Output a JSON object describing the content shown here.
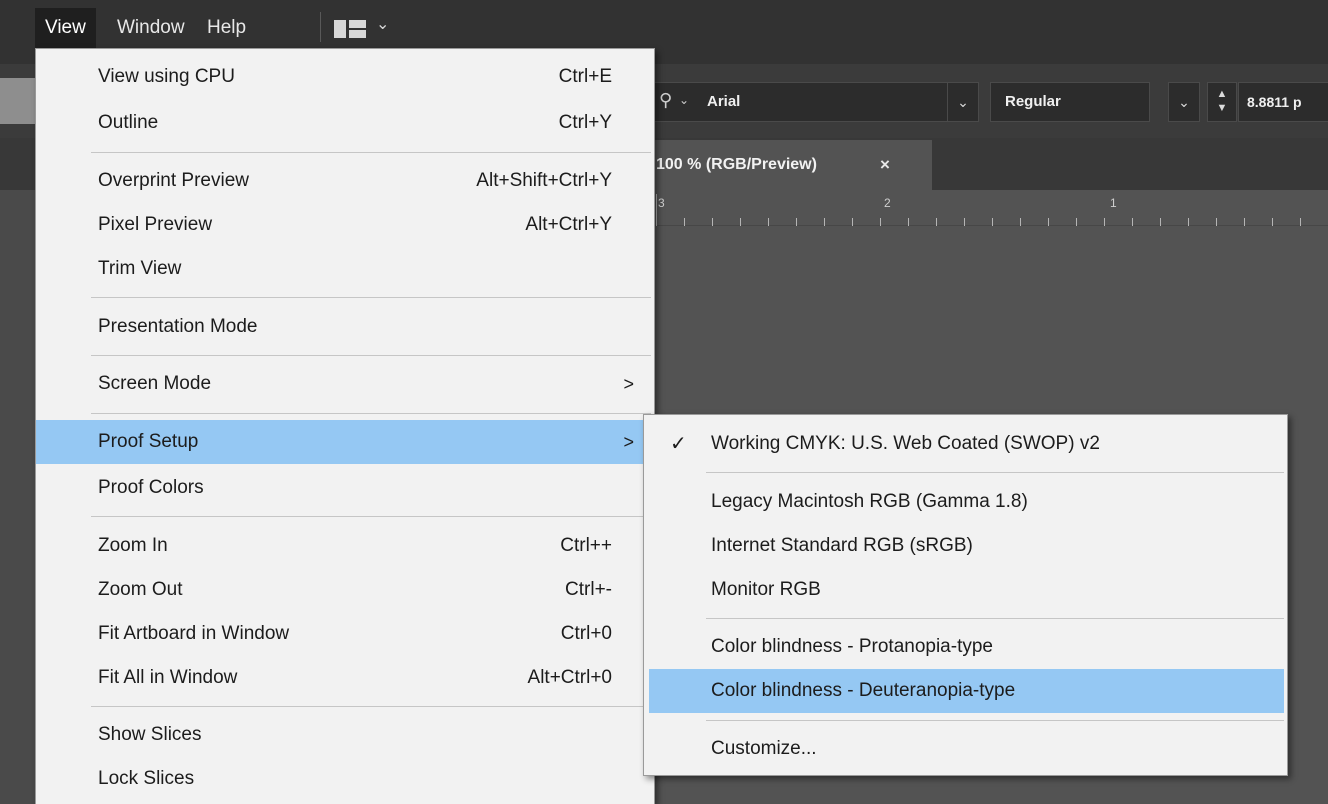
{
  "menubar": {
    "items": [
      "View",
      "Window",
      "Help"
    ],
    "active": "View"
  },
  "control_bar": {
    "font_family": "Arial",
    "font_style": "Regular",
    "font_size": "8.8811 p"
  },
  "document_tab": {
    "title": "100 % (RGB/Preview)",
    "close": "×"
  },
  "ruler": {
    "labels": [
      "3",
      "2",
      "1"
    ]
  },
  "view_menu": {
    "items": [
      {
        "label": "View using CPU",
        "shortcut": "Ctrl+E"
      },
      {
        "label": "Outline",
        "shortcut": "Ctrl+Y"
      },
      {
        "label": "Overprint Preview",
        "shortcut": "Alt+Shift+Ctrl+Y"
      },
      {
        "label": "Pixel Preview",
        "shortcut": "Alt+Ctrl+Y"
      },
      {
        "label": "Trim View",
        "shortcut": ""
      },
      {
        "label": "Presentation Mode",
        "shortcut": ""
      },
      {
        "label": "Screen Mode",
        "shortcut": "",
        "submenu_arrow": ">"
      },
      {
        "label": "Proof Setup",
        "shortcut": "",
        "submenu_arrow": ">",
        "highlighted": true
      },
      {
        "label": "Proof Colors",
        "shortcut": ""
      },
      {
        "label": "Zoom In",
        "shortcut": "Ctrl++"
      },
      {
        "label": "Zoom Out",
        "shortcut": "Ctrl+-"
      },
      {
        "label": "Fit Artboard in Window",
        "shortcut": "Ctrl+0"
      },
      {
        "label": "Fit All in Window",
        "shortcut": "Alt+Ctrl+0"
      },
      {
        "label": "Show Slices",
        "shortcut": ""
      },
      {
        "label": "Lock Slices",
        "shortcut": ""
      }
    ]
  },
  "proof_setup_menu": {
    "items": [
      {
        "label": "Working CMYK: U.S. Web Coated (SWOP) v2",
        "checked": true,
        "check_glyph": "✓"
      },
      {
        "label": "Legacy Macintosh RGB (Gamma 1.8)"
      },
      {
        "label": "Internet Standard RGB (sRGB)"
      },
      {
        "label": "Monitor RGB"
      },
      {
        "label": "Color blindness - Protanopia-type"
      },
      {
        "label": "Color blindness - Deuteranopia-type",
        "highlighted": true
      },
      {
        "label": "Customize..."
      }
    ]
  },
  "colors": {
    "menu_bg": "#f2f2f2",
    "highlight": "#95c8f3",
    "app_bg": "#535353",
    "menubar_bg": "#323232"
  },
  "icons": {
    "workspace_switcher": "workspace-layout-icon",
    "font_search": "search-icon",
    "checkmark": "checkmark-icon",
    "submenu": "chevron-right-icon"
  }
}
